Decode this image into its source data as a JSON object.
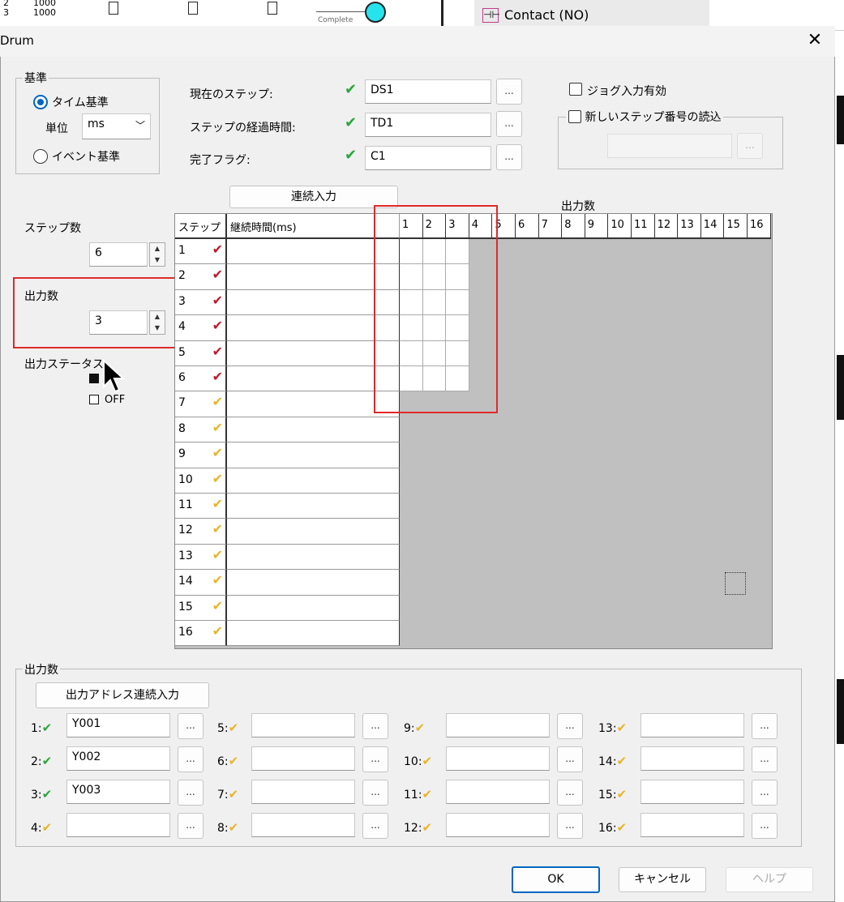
{
  "background": {
    "rows": [
      {
        "n": "2",
        "v": "1000"
      },
      {
        "n": "3",
        "v": "1000"
      }
    ],
    "complete_label": "Complete",
    "contact_item": "Contact (NO)"
  },
  "dialog": {
    "title": "Drum",
    "close_icon": "close-icon"
  },
  "basis": {
    "legend": "基準",
    "time_label": "タイム基準",
    "unit_label": "単位",
    "unit_value": "ms",
    "event_label": "イベント基準"
  },
  "state": {
    "current_step_label": "現在のステップ:",
    "current_step_value": "DS1",
    "elapsed_label": "ステップの経過時間:",
    "elapsed_value": "TD1",
    "done_label": "完了フラグ:",
    "done_value": "C1",
    "dots": "..."
  },
  "options": {
    "jog_label": "ジョグ入力有効",
    "newstep_label": "新しいステップ番号の読込"
  },
  "left": {
    "steps_label": "ステップ数",
    "steps_value": "6",
    "outputs_label": "出力数",
    "outputs_value": "3",
    "status_label": "出力ステータス",
    "off_label": "OFF"
  },
  "grid": {
    "fill_button": "連続入力",
    "outputs_header": "出力数",
    "step_col": "ステップ",
    "duration_col": "継続時間(ms)",
    "out_cols": [
      "1",
      "2",
      "3",
      "4",
      "5",
      "6",
      "7",
      "8",
      "9",
      "10",
      "11",
      "12",
      "13",
      "14",
      "15",
      "16"
    ],
    "steps": [
      "1",
      "2",
      "3",
      "4",
      "5",
      "6",
      "7",
      "8",
      "9",
      "10",
      "11",
      "12",
      "13",
      "14",
      "15",
      "16"
    ],
    "active_steps": 6,
    "active_outputs": 3
  },
  "outputs": {
    "legend": "出力数",
    "fill_button": "出力アドレス連続入力",
    "items": [
      {
        "label": "1:",
        "value": "Y001",
        "active": true
      },
      {
        "label": "2:",
        "value": "Y002",
        "active": true
      },
      {
        "label": "3:",
        "value": "Y003",
        "active": true
      },
      {
        "label": "4:",
        "value": "",
        "active": false
      },
      {
        "label": "5:",
        "value": "",
        "active": false
      },
      {
        "label": "6:",
        "value": "",
        "active": false
      },
      {
        "label": "7:",
        "value": "",
        "active": false
      },
      {
        "label": "8:",
        "value": "",
        "active": false
      },
      {
        "label": "9:",
        "value": "",
        "active": false
      },
      {
        "label": "10:",
        "value": "",
        "active": false
      },
      {
        "label": "11:",
        "value": "",
        "active": false
      },
      {
        "label": "12:",
        "value": "",
        "active": false
      },
      {
        "label": "13:",
        "value": "",
        "active": false
      },
      {
        "label": "14:",
        "value": "",
        "active": false
      },
      {
        "label": "15:",
        "value": "",
        "active": false
      },
      {
        "label": "16:",
        "value": "",
        "active": false
      }
    ]
  },
  "footer": {
    "ok": "OK",
    "cancel": "キャンセル",
    "help": "ヘルプ"
  }
}
